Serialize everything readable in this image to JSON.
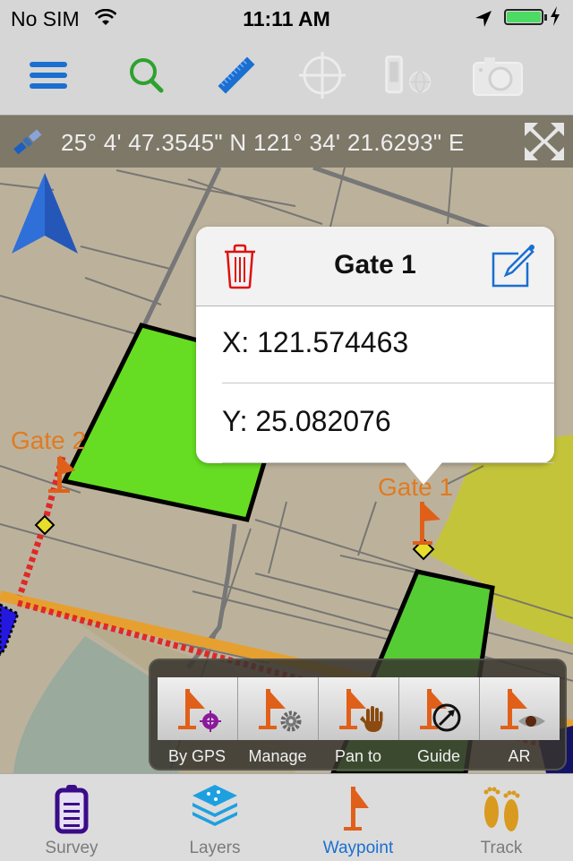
{
  "status_bar": {
    "carrier": "No SIM",
    "time": "11:11 AM",
    "battery_level": 1.0,
    "charging": true
  },
  "toolbar": {
    "buttons": [
      {
        "name": "menu",
        "icon": "hamburger-icon",
        "enabled": true
      },
      {
        "name": "search",
        "icon": "search-icon",
        "enabled": true
      },
      {
        "name": "measure",
        "icon": "ruler-icon",
        "enabled": true
      },
      {
        "name": "locate",
        "icon": "crosshair-icon",
        "enabled": false
      },
      {
        "name": "device-web",
        "icon": "device-globe-icon",
        "enabled": false
      },
      {
        "name": "camera",
        "icon": "camera-icon",
        "enabled": false
      }
    ]
  },
  "coord_bar": {
    "text": "25° 4' 47.3545\" N 121° 34' 21.6293\" E"
  },
  "map": {
    "waypoints": [
      {
        "label": "Gate 2"
      },
      {
        "label": "Gate 1"
      }
    ]
  },
  "popup": {
    "title": "Gate 1",
    "x_label": "X: 121.574463",
    "y_label": "Y: 25.082076"
  },
  "waypoint_panel": {
    "items": [
      {
        "label": "By GPS",
        "badge": "gps-target-icon"
      },
      {
        "label": "Manage",
        "badge": "gear-icon"
      },
      {
        "label": "Pan to",
        "badge": "hand-icon"
      },
      {
        "label": "Guide",
        "badge": "compass-icon"
      },
      {
        "label": "AR",
        "badge": "eye-icon"
      }
    ]
  },
  "tab_bar": {
    "tabs": [
      {
        "label": "Survey",
        "icon": "clipboard-icon",
        "active": false
      },
      {
        "label": "Layers",
        "icon": "layers-icon",
        "active": false
      },
      {
        "label": "Waypoint",
        "icon": "flag-icon",
        "active": true
      },
      {
        "label": "Track",
        "icon": "footprints-icon",
        "active": false
      }
    ]
  },
  "colors": {
    "accent": "#1a6fd1",
    "flag": "#e0601a",
    "delete": "#e01010",
    "map_bg": "#bcb29c",
    "polygon": "#66dd22"
  }
}
